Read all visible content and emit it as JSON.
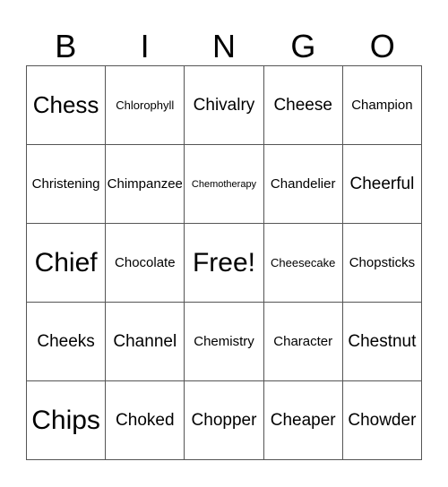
{
  "header": [
    "B",
    "I",
    "N",
    "G",
    "O"
  ],
  "cells": [
    [
      {
        "text": "Chess",
        "size": "xl"
      },
      {
        "text": "Chlorophyll",
        "size": "s"
      },
      {
        "text": "Chivalry",
        "size": "l"
      },
      {
        "text": "Cheese",
        "size": "l"
      },
      {
        "text": "Champion",
        "size": "m"
      }
    ],
    [
      {
        "text": "Christening",
        "size": "m"
      },
      {
        "text": "Chimpanzee",
        "size": "m"
      },
      {
        "text": "Chemotherapy",
        "size": "xs"
      },
      {
        "text": "Chandelier",
        "size": "m"
      },
      {
        "text": "Cheerful",
        "size": "l"
      }
    ],
    [
      {
        "text": "Chief",
        "size": "xxl"
      },
      {
        "text": "Chocolate",
        "size": "m"
      },
      {
        "text": "Free!",
        "size": "xxl"
      },
      {
        "text": "Cheesecake",
        "size": "s"
      },
      {
        "text": "Chopsticks",
        "size": "m"
      }
    ],
    [
      {
        "text": "Cheeks",
        "size": "l"
      },
      {
        "text": "Channel",
        "size": "l"
      },
      {
        "text": "Chemistry",
        "size": "m"
      },
      {
        "text": "Character",
        "size": "m"
      },
      {
        "text": "Chestnut",
        "size": "l"
      }
    ],
    [
      {
        "text": "Chips",
        "size": "xxl"
      },
      {
        "text": "Choked",
        "size": "l"
      },
      {
        "text": "Chopper",
        "size": "l"
      },
      {
        "text": "Cheaper",
        "size": "l"
      },
      {
        "text": "Chowder",
        "size": "l"
      }
    ]
  ]
}
